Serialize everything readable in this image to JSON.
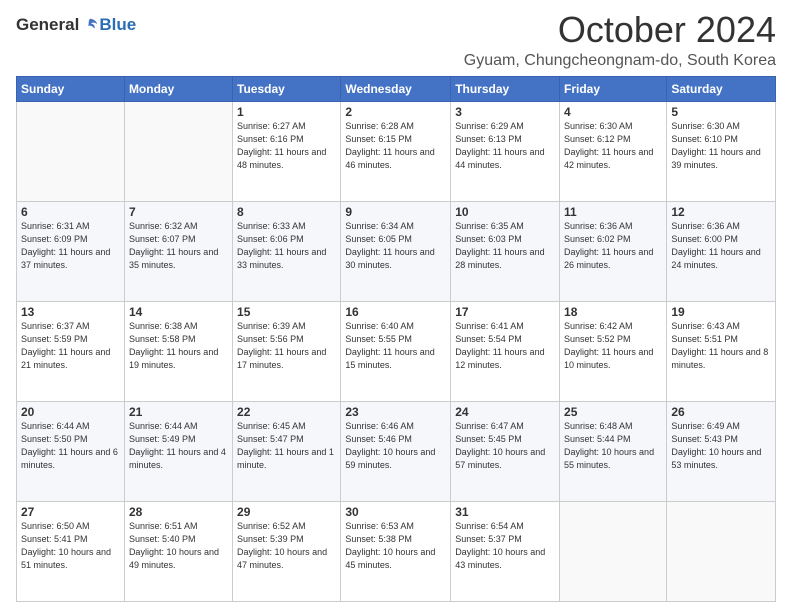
{
  "logo": {
    "general": "General",
    "blue": "Blue"
  },
  "header": {
    "month": "October 2024",
    "location": "Gyuam, Chungcheongnam-do, South Korea"
  },
  "weekdays": [
    "Sunday",
    "Monday",
    "Tuesday",
    "Wednesday",
    "Thursday",
    "Friday",
    "Saturday"
  ],
  "weeks": [
    [
      {
        "day": "",
        "sunrise": "",
        "sunset": "",
        "daylight": ""
      },
      {
        "day": "",
        "sunrise": "",
        "sunset": "",
        "daylight": ""
      },
      {
        "day": "1",
        "sunrise": "Sunrise: 6:27 AM",
        "sunset": "Sunset: 6:16 PM",
        "daylight": "Daylight: 11 hours and 48 minutes."
      },
      {
        "day": "2",
        "sunrise": "Sunrise: 6:28 AM",
        "sunset": "Sunset: 6:15 PM",
        "daylight": "Daylight: 11 hours and 46 minutes."
      },
      {
        "day": "3",
        "sunrise": "Sunrise: 6:29 AM",
        "sunset": "Sunset: 6:13 PM",
        "daylight": "Daylight: 11 hours and 44 minutes."
      },
      {
        "day": "4",
        "sunrise": "Sunrise: 6:30 AM",
        "sunset": "Sunset: 6:12 PM",
        "daylight": "Daylight: 11 hours and 42 minutes."
      },
      {
        "day": "5",
        "sunrise": "Sunrise: 6:30 AM",
        "sunset": "Sunset: 6:10 PM",
        "daylight": "Daylight: 11 hours and 39 minutes."
      }
    ],
    [
      {
        "day": "6",
        "sunrise": "Sunrise: 6:31 AM",
        "sunset": "Sunset: 6:09 PM",
        "daylight": "Daylight: 11 hours and 37 minutes."
      },
      {
        "day": "7",
        "sunrise": "Sunrise: 6:32 AM",
        "sunset": "Sunset: 6:07 PM",
        "daylight": "Daylight: 11 hours and 35 minutes."
      },
      {
        "day": "8",
        "sunrise": "Sunrise: 6:33 AM",
        "sunset": "Sunset: 6:06 PM",
        "daylight": "Daylight: 11 hours and 33 minutes."
      },
      {
        "day": "9",
        "sunrise": "Sunrise: 6:34 AM",
        "sunset": "Sunset: 6:05 PM",
        "daylight": "Daylight: 11 hours and 30 minutes."
      },
      {
        "day": "10",
        "sunrise": "Sunrise: 6:35 AM",
        "sunset": "Sunset: 6:03 PM",
        "daylight": "Daylight: 11 hours and 28 minutes."
      },
      {
        "day": "11",
        "sunrise": "Sunrise: 6:36 AM",
        "sunset": "Sunset: 6:02 PM",
        "daylight": "Daylight: 11 hours and 26 minutes."
      },
      {
        "day": "12",
        "sunrise": "Sunrise: 6:36 AM",
        "sunset": "Sunset: 6:00 PM",
        "daylight": "Daylight: 11 hours and 24 minutes."
      }
    ],
    [
      {
        "day": "13",
        "sunrise": "Sunrise: 6:37 AM",
        "sunset": "Sunset: 5:59 PM",
        "daylight": "Daylight: 11 hours and 21 minutes."
      },
      {
        "day": "14",
        "sunrise": "Sunrise: 6:38 AM",
        "sunset": "Sunset: 5:58 PM",
        "daylight": "Daylight: 11 hours and 19 minutes."
      },
      {
        "day": "15",
        "sunrise": "Sunrise: 6:39 AM",
        "sunset": "Sunset: 5:56 PM",
        "daylight": "Daylight: 11 hours and 17 minutes."
      },
      {
        "day": "16",
        "sunrise": "Sunrise: 6:40 AM",
        "sunset": "Sunset: 5:55 PM",
        "daylight": "Daylight: 11 hours and 15 minutes."
      },
      {
        "day": "17",
        "sunrise": "Sunrise: 6:41 AM",
        "sunset": "Sunset: 5:54 PM",
        "daylight": "Daylight: 11 hours and 12 minutes."
      },
      {
        "day": "18",
        "sunrise": "Sunrise: 6:42 AM",
        "sunset": "Sunset: 5:52 PM",
        "daylight": "Daylight: 11 hours and 10 minutes."
      },
      {
        "day": "19",
        "sunrise": "Sunrise: 6:43 AM",
        "sunset": "Sunset: 5:51 PM",
        "daylight": "Daylight: 11 hours and 8 minutes."
      }
    ],
    [
      {
        "day": "20",
        "sunrise": "Sunrise: 6:44 AM",
        "sunset": "Sunset: 5:50 PM",
        "daylight": "Daylight: 11 hours and 6 minutes."
      },
      {
        "day": "21",
        "sunrise": "Sunrise: 6:44 AM",
        "sunset": "Sunset: 5:49 PM",
        "daylight": "Daylight: 11 hours and 4 minutes."
      },
      {
        "day": "22",
        "sunrise": "Sunrise: 6:45 AM",
        "sunset": "Sunset: 5:47 PM",
        "daylight": "Daylight: 11 hours and 1 minute."
      },
      {
        "day": "23",
        "sunrise": "Sunrise: 6:46 AM",
        "sunset": "Sunset: 5:46 PM",
        "daylight": "Daylight: 10 hours and 59 minutes."
      },
      {
        "day": "24",
        "sunrise": "Sunrise: 6:47 AM",
        "sunset": "Sunset: 5:45 PM",
        "daylight": "Daylight: 10 hours and 57 minutes."
      },
      {
        "day": "25",
        "sunrise": "Sunrise: 6:48 AM",
        "sunset": "Sunset: 5:44 PM",
        "daylight": "Daylight: 10 hours and 55 minutes."
      },
      {
        "day": "26",
        "sunrise": "Sunrise: 6:49 AM",
        "sunset": "Sunset: 5:43 PM",
        "daylight": "Daylight: 10 hours and 53 minutes."
      }
    ],
    [
      {
        "day": "27",
        "sunrise": "Sunrise: 6:50 AM",
        "sunset": "Sunset: 5:41 PM",
        "daylight": "Daylight: 10 hours and 51 minutes."
      },
      {
        "day": "28",
        "sunrise": "Sunrise: 6:51 AM",
        "sunset": "Sunset: 5:40 PM",
        "daylight": "Daylight: 10 hours and 49 minutes."
      },
      {
        "day": "29",
        "sunrise": "Sunrise: 6:52 AM",
        "sunset": "Sunset: 5:39 PM",
        "daylight": "Daylight: 10 hours and 47 minutes."
      },
      {
        "day": "30",
        "sunrise": "Sunrise: 6:53 AM",
        "sunset": "Sunset: 5:38 PM",
        "daylight": "Daylight: 10 hours and 45 minutes."
      },
      {
        "day": "31",
        "sunrise": "Sunrise: 6:54 AM",
        "sunset": "Sunset: 5:37 PM",
        "daylight": "Daylight: 10 hours and 43 minutes."
      },
      {
        "day": "",
        "sunrise": "",
        "sunset": "",
        "daylight": ""
      },
      {
        "day": "",
        "sunrise": "",
        "sunset": "",
        "daylight": ""
      }
    ]
  ]
}
